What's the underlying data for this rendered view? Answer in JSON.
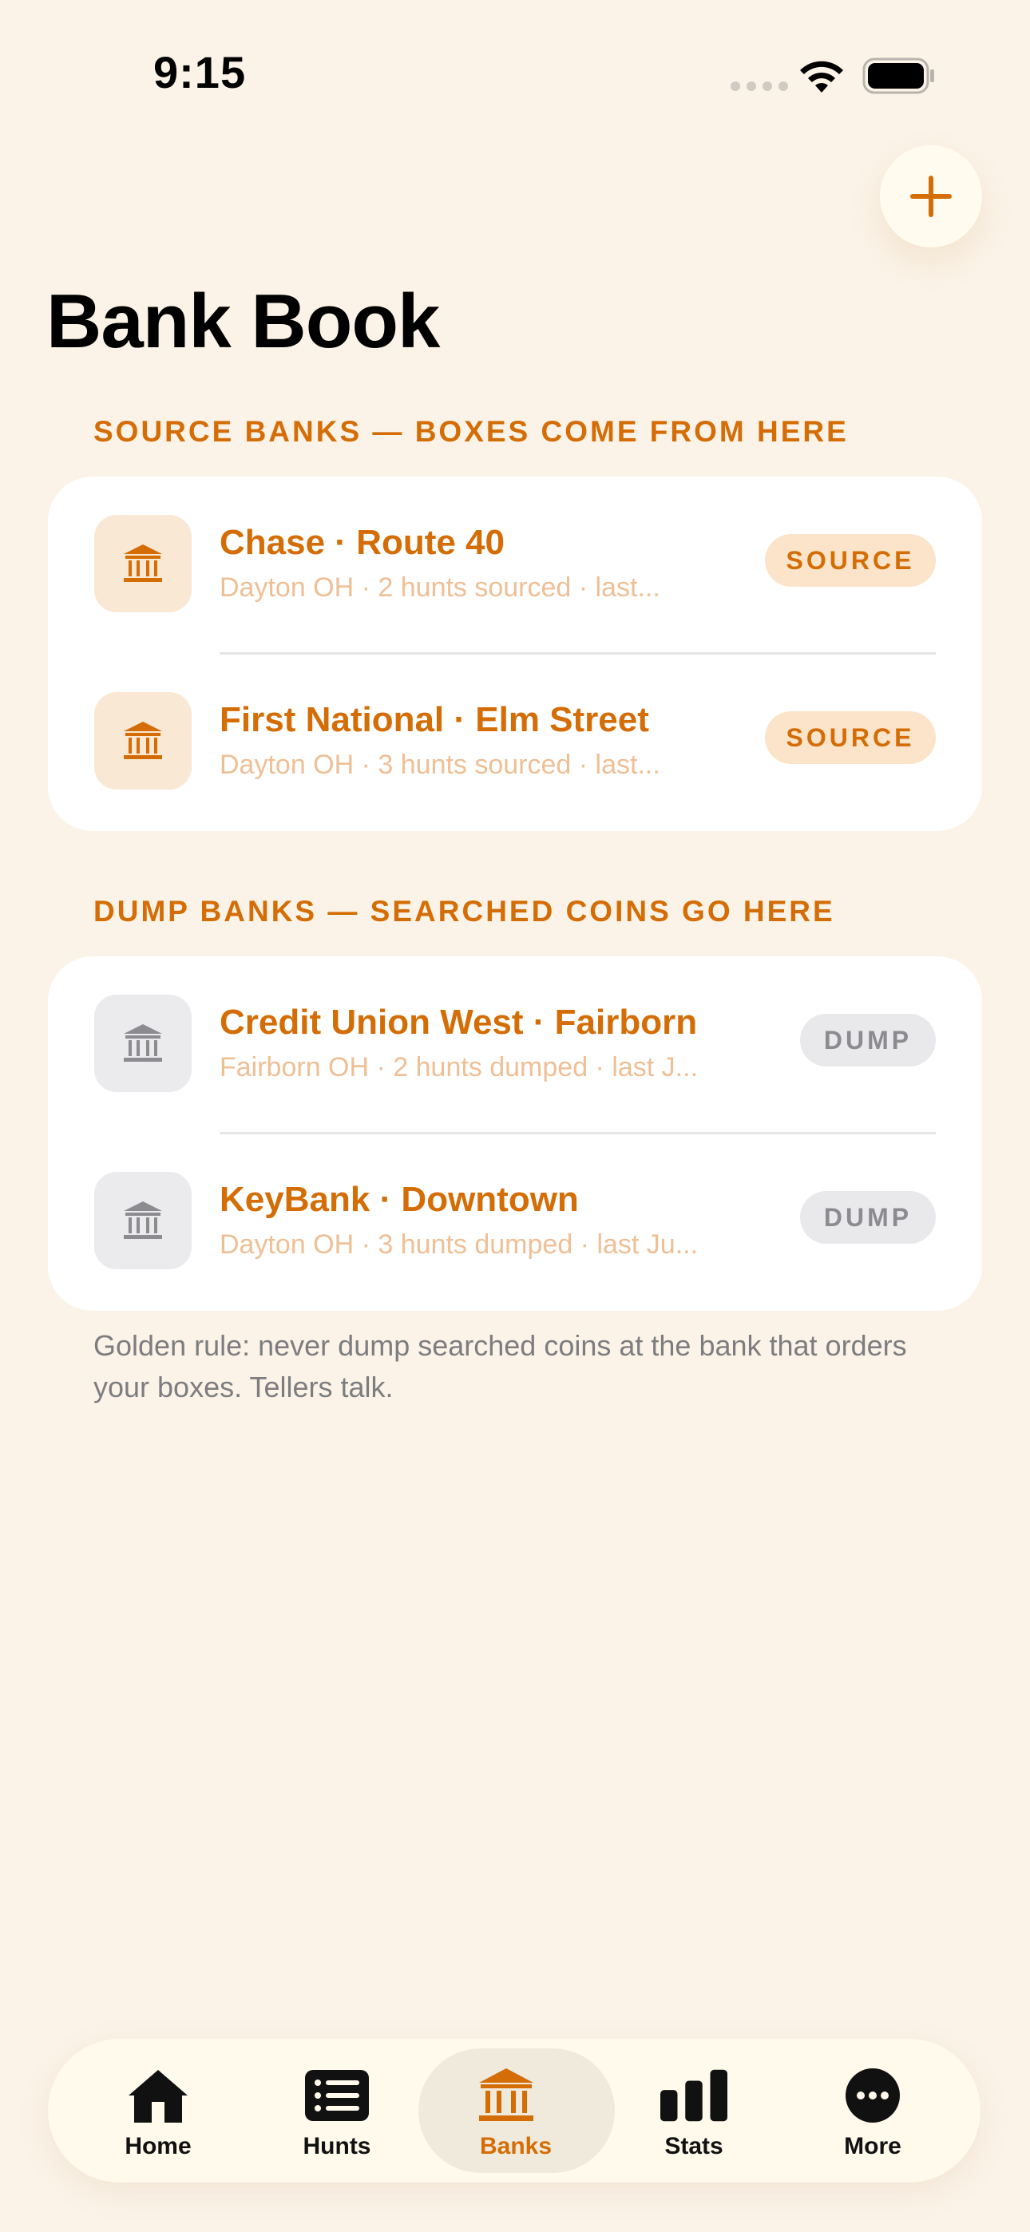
{
  "status_bar": {
    "time": "9:15"
  },
  "header": {
    "title": "Bank Book"
  },
  "colors": {
    "accent": "#d46d05",
    "background": "#fbf3e8",
    "dump_gray": "#8b8b90"
  },
  "source_section": {
    "label": "SOURCE BANKS — BOXES COME FROM HERE",
    "items": [
      {
        "name": "Chase · Route 40",
        "detail": "Dayton OH · 2 hunts sourced · last...",
        "badge": "SOURCE",
        "icon": "bank-icon"
      },
      {
        "name": "First National · Elm Street",
        "detail": "Dayton OH · 3 hunts sourced · last...",
        "badge": "SOURCE",
        "icon": "bank-icon"
      }
    ]
  },
  "dump_section": {
    "label": "DUMP BANKS — SEARCHED COINS GO HERE",
    "items": [
      {
        "name": "Credit Union West · Fairborn",
        "detail": "Fairborn OH · 2 hunts dumped · last J...",
        "badge": "DUMP",
        "icon": "bank-icon"
      },
      {
        "name": "KeyBank · Downtown",
        "detail": "Dayton OH · 3 hunts dumped · last Ju...",
        "badge": "DUMP",
        "icon": "bank-icon"
      }
    ]
  },
  "footnote": "Golden rule: never dump searched coins at the bank that orders your boxes. Tellers talk.",
  "tab_bar": {
    "tabs": [
      {
        "label": "Home",
        "icon": "house-icon"
      },
      {
        "label": "Hunts",
        "icon": "list-icon"
      },
      {
        "label": "Banks",
        "icon": "bank-icon",
        "active": true
      },
      {
        "label": "Stats",
        "icon": "bar-chart-icon"
      },
      {
        "label": "More",
        "icon": "ellipsis-icon"
      }
    ]
  }
}
